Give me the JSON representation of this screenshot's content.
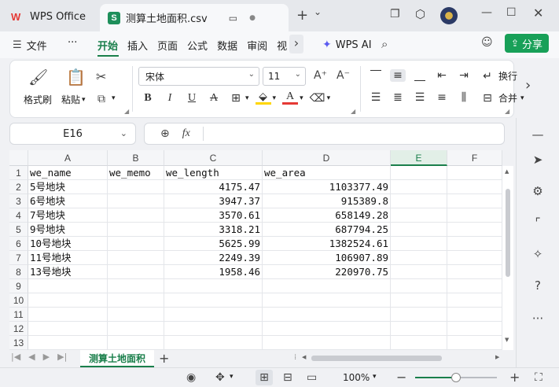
{
  "titlebar": {
    "app_name": "WPS Office",
    "doc_tab": "测算土地面积.csv",
    "add_tab": "+",
    "add_dropdown": "⌄"
  },
  "menu": {
    "file_label": "文件",
    "more": "···",
    "tabs": [
      "开始",
      "插入",
      "页面",
      "公式",
      "数据",
      "审阅",
      "视"
    ],
    "active_tab": "开始",
    "more_arrow": "›",
    "wps_ai": "WPS AI",
    "share": "分享"
  },
  "ribbon": {
    "format_painter": "格式刷",
    "paste": "粘贴",
    "font_name": "宋体",
    "font_size": "11",
    "wrap": "换行",
    "merge": "合并"
  },
  "formula": {
    "cell_ref": "E16",
    "fx": "fx",
    "value": ""
  },
  "grid": {
    "columns": [
      {
        "id": "A",
        "selected": false
      },
      {
        "id": "B",
        "selected": false
      },
      {
        "id": "C",
        "selected": false
      },
      {
        "id": "D",
        "selected": false
      },
      {
        "id": "E",
        "selected": true
      },
      {
        "id": "F",
        "selected": false
      }
    ],
    "row_numbers": [
      "1",
      "2",
      "3",
      "4",
      "5",
      "6",
      "7",
      "8",
      "9",
      "10",
      "11",
      "12",
      "13"
    ],
    "rows": [
      [
        "we_name",
        "we_memo",
        "we_length",
        "we_area",
        "",
        ""
      ],
      [
        "5号地块",
        "",
        "4175.47",
        "1103377.49",
        "",
        ""
      ],
      [
        "6号地块",
        "",
        "3947.37",
        "915389.8",
        "",
        ""
      ],
      [
        "7号地块",
        "",
        "3570.61",
        "658149.28",
        "",
        ""
      ],
      [
        "9号地块",
        "",
        "3318.21",
        "687794.25",
        "",
        ""
      ],
      [
        "10号地块",
        "",
        "5625.99",
        "1382524.61",
        "",
        ""
      ],
      [
        "11号地块",
        "",
        "2249.39",
        "106907.89",
        "",
        ""
      ],
      [
        "13号地块",
        "",
        "1958.46",
        "220970.75",
        "",
        ""
      ],
      [
        "",
        "",
        "",
        "",
        "",
        ""
      ],
      [
        "",
        "",
        "",
        "",
        "",
        ""
      ],
      [
        "",
        "",
        "",
        "",
        "",
        ""
      ],
      [
        "",
        "",
        "",
        "",
        "",
        ""
      ],
      [
        "",
        "",
        "",
        "",
        "",
        ""
      ]
    ]
  },
  "sheets": {
    "active": "测算土地面积",
    "add": "+"
  },
  "status": {
    "zoom": "100%",
    "zoom_level": 0.5
  },
  "colors": {
    "accent": "#1a7f4b",
    "share": "#18a058",
    "font_color": "#e53935",
    "highlight": "#ffd600"
  }
}
